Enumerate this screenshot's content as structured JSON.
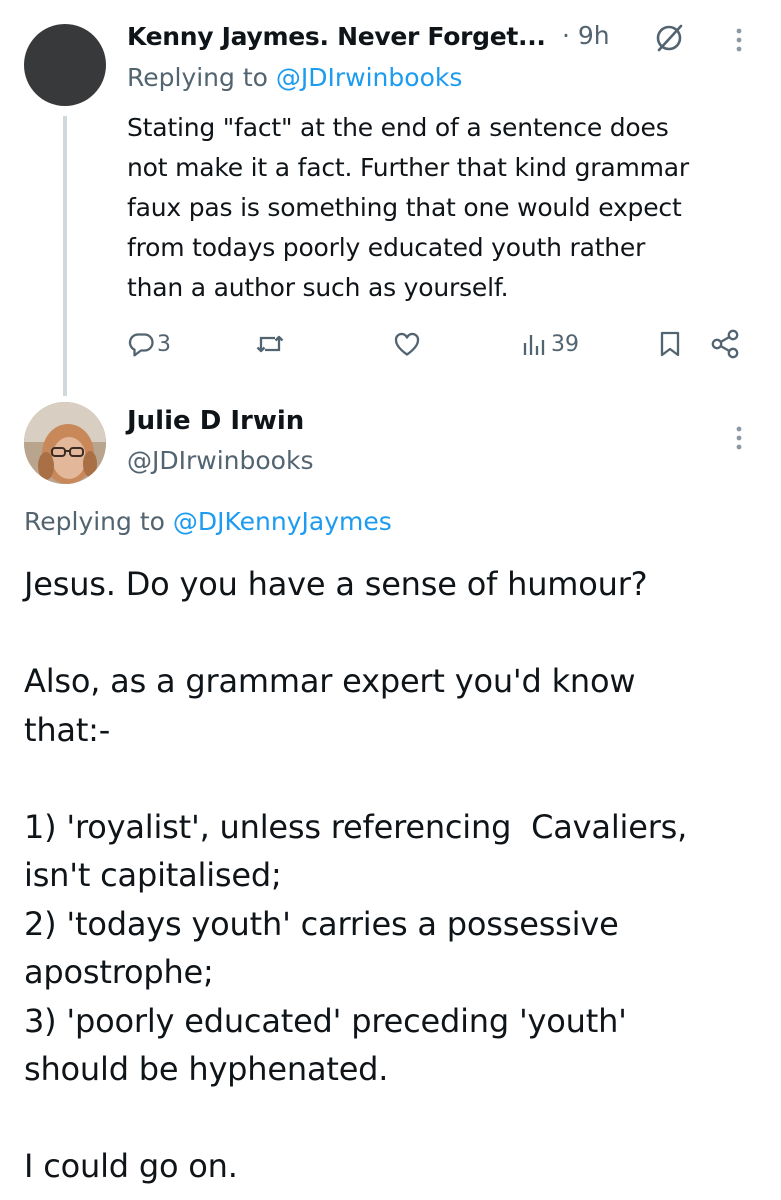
{
  "tweet1": {
    "author_name": "Kenny Jaymes. Never Forget...",
    "time": "· 9h",
    "replying_prefix": "Replying to ",
    "replying_handle": "@JDIrwinbooks",
    "body": "Stating \"fact\" at the end of a sentence does\nnot make it a fact. Further that kind grammar\nfaux pas is something that one would expect\nfrom todays poorly educated youth rather\nthan a author such as yourself.",
    "actions": {
      "replies": "3",
      "reposts": "",
      "likes": "",
      "views": "39"
    },
    "icons": [
      "grok-icon",
      "more-icon",
      "reply-icon",
      "repost-icon",
      "like-icon",
      "views-icon",
      "bookmark-icon",
      "share-icon"
    ]
  },
  "tweet2": {
    "author_name": "Julie D Irwin",
    "author_handle": "@JDIrwinbooks",
    "replying_prefix": "Replying to ",
    "replying_handle": "@DJKennyJaymes",
    "body": "Jesus. Do you have a sense of humour?\n\nAlso, as a grammar expert you'd know\nthat:-\n\n1) 'royalist', unless referencing  Cavaliers,\nisn't capitalised;\n2) 'todays youth' carries a possessive\napostrophe;\n3) 'poorly educated' preceding 'youth'\nshould be hyphenated.\n\nI could go on.",
    "icons": [
      "avatar",
      "more-icon"
    ]
  },
  "colors": {
    "text_primary": "#0f1419",
    "text_secondary": "#536471",
    "link": "#1d9bf0",
    "thread_line": "#cfd9de",
    "avatar_dark": "#38393b"
  }
}
